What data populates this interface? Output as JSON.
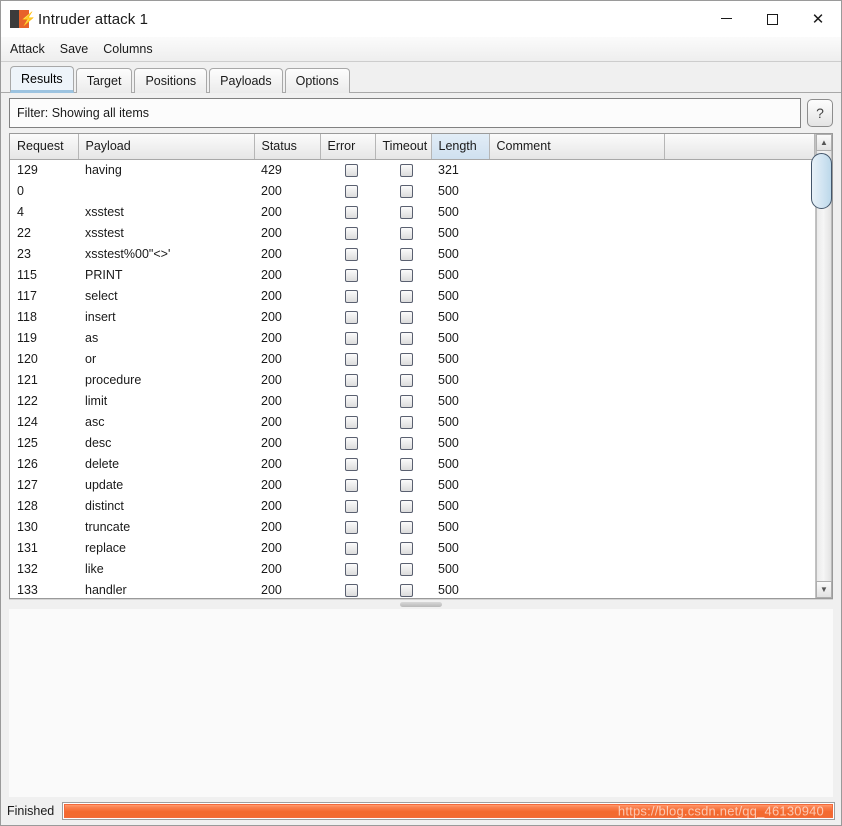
{
  "window": {
    "title": "Intruder attack 1",
    "icon": "burp-logo-icon",
    "minimize_label": "–",
    "maximize_label": "□",
    "close_label": "✕"
  },
  "menubar": {
    "items": [
      {
        "label": "Attack"
      },
      {
        "label": "Save"
      },
      {
        "label": "Columns"
      }
    ]
  },
  "tabs": [
    {
      "label": "Results",
      "active": true
    },
    {
      "label": "Target",
      "active": false
    },
    {
      "label": "Positions",
      "active": false
    },
    {
      "label": "Payloads",
      "active": false
    },
    {
      "label": "Options",
      "active": false
    }
  ],
  "filter": {
    "text": "Filter: Showing all items",
    "help_label": "?"
  },
  "table": {
    "columns": [
      {
        "key": "request",
        "label": "Request",
        "sorted": false
      },
      {
        "key": "payload",
        "label": "Payload",
        "sorted": false
      },
      {
        "key": "status",
        "label": "Status",
        "sorted": false
      },
      {
        "key": "error",
        "label": "Error",
        "sorted": false
      },
      {
        "key": "timeout",
        "label": "Timeout",
        "sorted": false
      },
      {
        "key": "length",
        "label": "Length",
        "sorted": true,
        "sort_arrow": "▲"
      },
      {
        "key": "comment",
        "label": "Comment",
        "sorted": false
      }
    ],
    "rows": [
      {
        "request": "129",
        "payload": "having",
        "status": "429",
        "error": false,
        "timeout": false,
        "length": "321",
        "comment": ""
      },
      {
        "request": "0",
        "payload": "",
        "status": "200",
        "error": false,
        "timeout": false,
        "length": "500",
        "comment": ""
      },
      {
        "request": "4",
        "payload": "xsstest",
        "status": "200",
        "error": false,
        "timeout": false,
        "length": "500",
        "comment": ""
      },
      {
        "request": "22",
        "payload": "xsstest",
        "status": "200",
        "error": false,
        "timeout": false,
        "length": "500",
        "comment": ""
      },
      {
        "request": "23",
        "payload": "xsstest%00\"<>'",
        "status": "200",
        "error": false,
        "timeout": false,
        "length": "500",
        "comment": ""
      },
      {
        "request": "115",
        "payload": "PRINT",
        "status": "200",
        "error": false,
        "timeout": false,
        "length": "500",
        "comment": ""
      },
      {
        "request": "117",
        "payload": "select",
        "status": "200",
        "error": false,
        "timeout": false,
        "length": "500",
        "comment": ""
      },
      {
        "request": "118",
        "payload": "insert",
        "status": "200",
        "error": false,
        "timeout": false,
        "length": "500",
        "comment": ""
      },
      {
        "request": "119",
        "payload": "as",
        "status": "200",
        "error": false,
        "timeout": false,
        "length": "500",
        "comment": ""
      },
      {
        "request": "120",
        "payload": "or",
        "status": "200",
        "error": false,
        "timeout": false,
        "length": "500",
        "comment": ""
      },
      {
        "request": "121",
        "payload": "procedure",
        "status": "200",
        "error": false,
        "timeout": false,
        "length": "500",
        "comment": ""
      },
      {
        "request": "122",
        "payload": "limit",
        "status": "200",
        "error": false,
        "timeout": false,
        "length": "500",
        "comment": ""
      },
      {
        "request": "124",
        "payload": "asc",
        "status": "200",
        "error": false,
        "timeout": false,
        "length": "500",
        "comment": ""
      },
      {
        "request": "125",
        "payload": "desc",
        "status": "200",
        "error": false,
        "timeout": false,
        "length": "500",
        "comment": ""
      },
      {
        "request": "126",
        "payload": "delete",
        "status": "200",
        "error": false,
        "timeout": false,
        "length": "500",
        "comment": ""
      },
      {
        "request": "127",
        "payload": "update",
        "status": "200",
        "error": false,
        "timeout": false,
        "length": "500",
        "comment": ""
      },
      {
        "request": "128",
        "payload": "distinct",
        "status": "200",
        "error": false,
        "timeout": false,
        "length": "500",
        "comment": ""
      },
      {
        "request": "130",
        "payload": "truncate",
        "status": "200",
        "error": false,
        "timeout": false,
        "length": "500",
        "comment": ""
      },
      {
        "request": "131",
        "payload": "replace",
        "status": "200",
        "error": false,
        "timeout": false,
        "length": "500",
        "comment": ""
      },
      {
        "request": "132",
        "payload": "like",
        "status": "200",
        "error": false,
        "timeout": false,
        "length": "500",
        "comment": ""
      },
      {
        "request": "133",
        "payload": "handler",
        "status": "200",
        "error": false,
        "timeout": false,
        "length": "500",
        "comment": ""
      }
    ]
  },
  "scrollbar": {
    "up_arrow": "▲",
    "down_arrow": "▼"
  },
  "statusbar": {
    "status_text": "Finished",
    "progress_percent": 100,
    "watermark": "https://blog.csdn.net/qq_46130940"
  },
  "colors": {
    "accent_orange": "#f4692f",
    "burp_orange": "#e8622a",
    "sorted_header_blue": "#cfe0ef",
    "active_tab_underline": "#9cc3e0"
  }
}
